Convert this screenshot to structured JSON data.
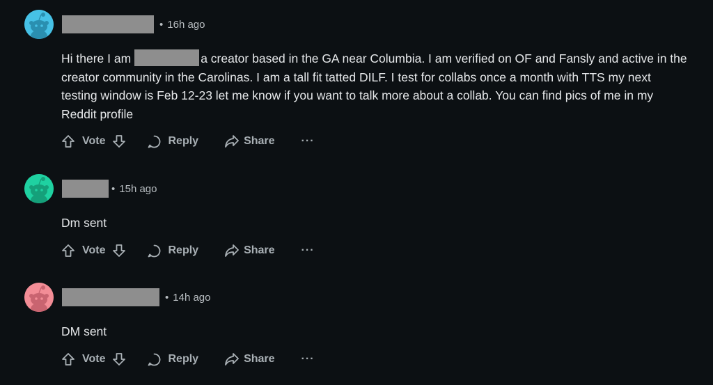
{
  "comments": [
    {
      "time": "16h ago",
      "avatar_color": "#46c1e6",
      "text_before": "Hi there I am",
      "text_after": "a creator based in the GA near Columbia. I am verified on OF and Fansly and active in the creator community in the Carolinas. I am a tall fit tatted DILF. I test for collabs once a month with TTS my next testing window is Feb 12-23 let me know if you want to talk more about a collab. You can find pics of me in my Reddit profile"
    },
    {
      "time": "15h ago",
      "avatar_color": "#1fd1a1",
      "text": "Dm sent"
    },
    {
      "time": "14h ago",
      "avatar_color": "#f38d96",
      "text": "DM sent"
    }
  ],
  "actions": {
    "vote_label": "Vote",
    "reply_label": "Reply",
    "share_label": "Share",
    "more_label": "···"
  },
  "separator": "•",
  "colors": {
    "background": "#0c1013",
    "text": "#e6e8ea",
    "meta": "#b9bec2",
    "action": "#a9b0b5",
    "redaction": "#8e8e8e"
  }
}
